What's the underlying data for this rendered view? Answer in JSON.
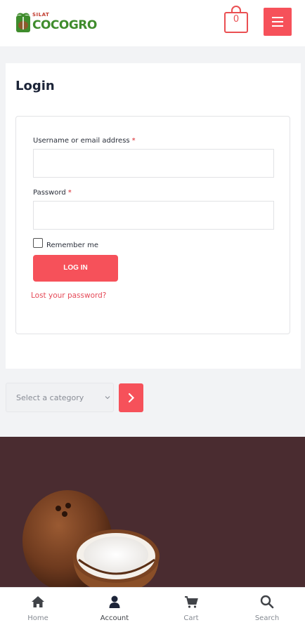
{
  "header": {
    "logo_small": "SILAT",
    "logo_text": "COCOGRO",
    "cart_count": "0",
    "brand_color": "#f6515a",
    "logo_green": "#3f8c2c"
  },
  "login": {
    "title": "Login",
    "username_label": "Username or email address",
    "password_label": "Password",
    "required_mark": "*",
    "username_value": "",
    "password_value": "",
    "remember_label": "Remember me",
    "remember_checked": false,
    "login_button": "LOG IN",
    "lost_password": "Lost your password?"
  },
  "category": {
    "placeholder": "Select a category"
  },
  "nav": {
    "items": [
      {
        "label": "Home",
        "icon": "home-icon"
      },
      {
        "label": "Account",
        "icon": "user-icon"
      },
      {
        "label": "Cart",
        "icon": "cart-icon"
      },
      {
        "label": "Search",
        "icon": "search-icon"
      }
    ],
    "active": "Account"
  }
}
